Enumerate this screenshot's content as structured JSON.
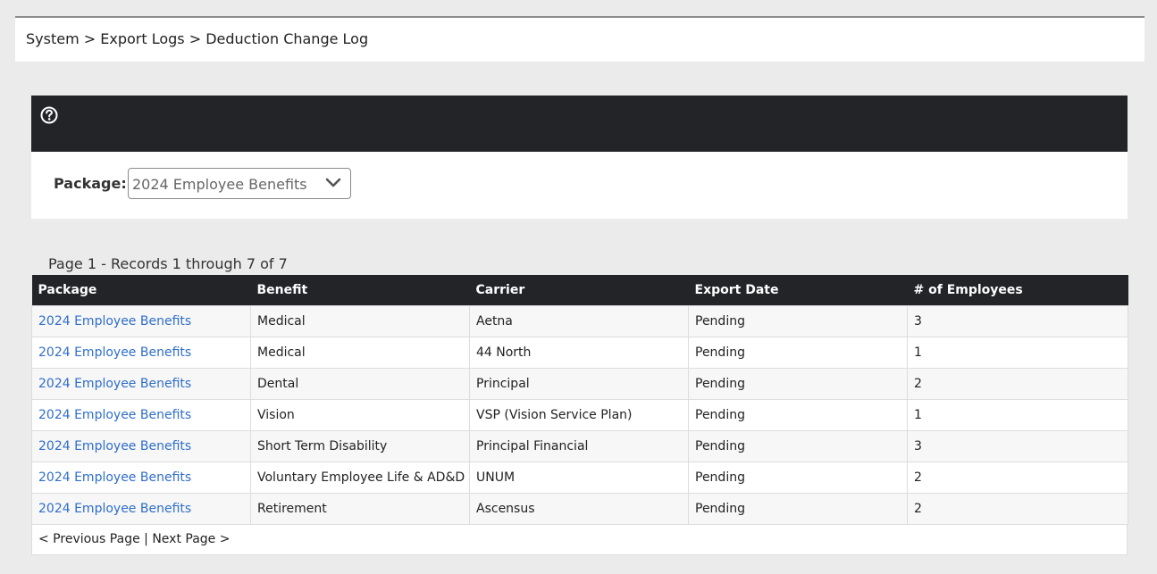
{
  "breadcrumb": {
    "text": "System > Export Logs > Deduction Change Log"
  },
  "icons": {
    "help": "help-icon"
  },
  "filter": {
    "package_label": "Package:",
    "package_value": "2024 Employee Benefits"
  },
  "records": {
    "info": "Page 1 - Records 1 through 7 of 7"
  },
  "table": {
    "headers": [
      "Package",
      "Benefit",
      "Carrier",
      "Export Date",
      "# of Employees"
    ],
    "rows": [
      {
        "package": "2024 Employee Benefits",
        "benefit": "Medical",
        "carrier": "Aetna",
        "export_date": "Pending",
        "employees": "3"
      },
      {
        "package": "2024 Employee Benefits",
        "benefit": "Medical",
        "carrier": "44 North",
        "export_date": "Pending",
        "employees": "1"
      },
      {
        "package": "2024 Employee Benefits",
        "benefit": "Dental",
        "carrier": "Principal",
        "export_date": "Pending",
        "employees": "2"
      },
      {
        "package": "2024 Employee Benefits",
        "benefit": "Vision",
        "carrier": "VSP (Vision Service Plan)",
        "export_date": "Pending",
        "employees": "1"
      },
      {
        "package": "2024 Employee Benefits",
        "benefit": "Short Term Disability",
        "carrier": "Principal Financial",
        "export_date": "Pending",
        "employees": "3"
      },
      {
        "package": "2024 Employee Benefits",
        "benefit": "Voluntary Employee Life & AD&D",
        "carrier": "UNUM",
        "export_date": "Pending",
        "employees": "2"
      },
      {
        "package": "2024 Employee Benefits",
        "benefit": "Retirement",
        "carrier": "Ascensus",
        "export_date": "Pending",
        "employees": "2"
      }
    ]
  },
  "pager": {
    "previous": "< Previous Page",
    "separator": "|",
    "next": "Next Page >"
  },
  "colors": {
    "header_bg": "#222428",
    "link": "#2f6ec9",
    "page_bg": "#ebebeb"
  }
}
